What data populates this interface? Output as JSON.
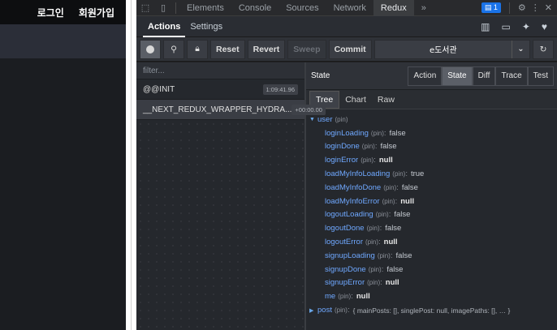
{
  "page": {
    "login": "로그인",
    "signup": "회원가입"
  },
  "devtools": {
    "tabs": [
      "Elements",
      "Console",
      "Sources",
      "Network",
      "Redux"
    ],
    "active_tab": "Redux",
    "more": "»",
    "badge_count": "1"
  },
  "redux": {
    "header_tabs": [
      "Actions",
      "Settings"
    ],
    "toolbar": {
      "reset": "Reset",
      "revert": "Revert",
      "sweep": "Sweep",
      "commit": "Commit",
      "instance": "e도서관"
    },
    "filter_placeholder": "filter...",
    "actions": [
      {
        "name": "@@INIT",
        "time": "1:09:41.96"
      },
      {
        "name": "__NEXT_REDUX_WRAPPER_HYDRA...",
        "time": "+00:00.00"
      }
    ],
    "state_label": "State",
    "monitor_buttons": [
      "Action",
      "State",
      "Diff",
      "Trace",
      "Test"
    ],
    "active_monitor": "State",
    "view_tabs": [
      "Tree",
      "Chart",
      "Raw"
    ],
    "active_view": "Tree",
    "pin_label": "(pin)",
    "tree": {
      "user_key": "user",
      "user_fields": [
        {
          "key": "loginLoading",
          "value": "false"
        },
        {
          "key": "loginDone",
          "value": "false"
        },
        {
          "key": "loginError",
          "value": "null"
        },
        {
          "key": "loadMyInfoLoading",
          "value": "true"
        },
        {
          "key": "loadMyInfoDone",
          "value": "false"
        },
        {
          "key": "loadMyInfoError",
          "value": "null"
        },
        {
          "key": "logoutLoading",
          "value": "false"
        },
        {
          "key": "logoutDone",
          "value": "false"
        },
        {
          "key": "logoutError",
          "value": "null"
        },
        {
          "key": "signupLoading",
          "value": "false"
        },
        {
          "key": "signupDone",
          "value": "false"
        },
        {
          "key": "signupError",
          "value": "null"
        },
        {
          "key": "me",
          "value": "null"
        }
      ],
      "post_key": "post",
      "post_preview": "{ mainPosts: [], singlePost: null, imagePaths: [], … }"
    }
  }
}
